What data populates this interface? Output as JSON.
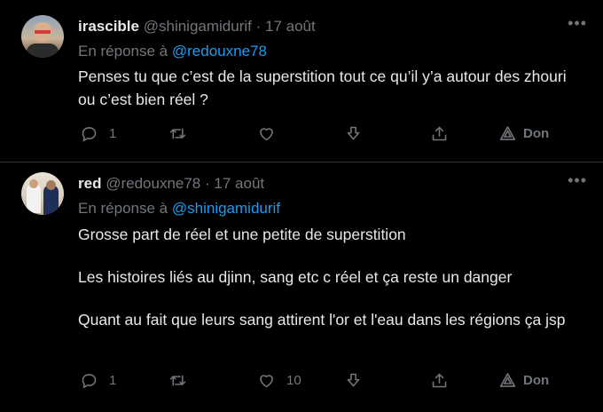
{
  "tweets": [
    {
      "author_name": "irascible",
      "author_handle": "@shinigamidurif",
      "separator": "·",
      "date": "17 août",
      "more_label": "•••",
      "reply_prefix": "En réponse à",
      "reply_mention": "@redouxne78",
      "body": [
        "Penses tu que c’est de la superstition tout ce qu’il y’a autour des zhouri ou c’est bien réel ?"
      ],
      "actions": {
        "reply_count": "1",
        "retweet_count": "",
        "like_count": "",
        "don_label": "Don"
      }
    },
    {
      "author_name": "red",
      "author_handle": "@redouxne78",
      "separator": "·",
      "date": "17 août",
      "more_label": "•••",
      "reply_prefix": "En réponse à",
      "reply_mention": "@shinigamidurif",
      "body": [
        "Grosse part de réel et une petite de superstition",
        "Les histoires liés au djinn, sang etc c réel et ça reste un danger",
        "Quant au fait que leurs sang attirent l'or et l'eau dans les régions ça jsp"
      ],
      "actions": {
        "reply_count": "1",
        "retweet_count": "",
        "like_count": "10",
        "don_label": "Don"
      }
    }
  ],
  "icons": [
    "avatar",
    "more-icon",
    "reply-icon",
    "retweet-icon",
    "like-icon",
    "download-icon",
    "share-icon",
    "don-icon"
  ]
}
